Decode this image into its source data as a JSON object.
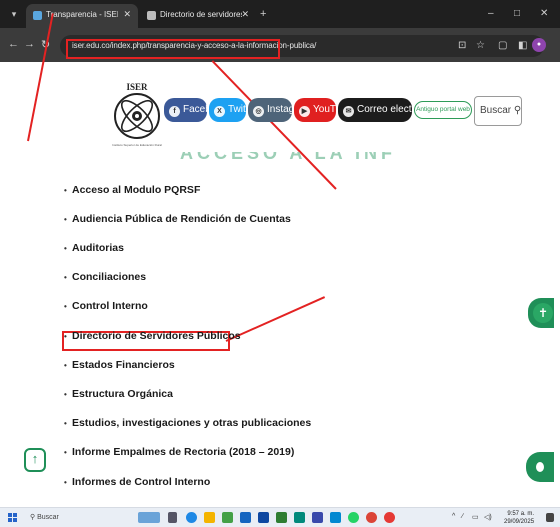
{
  "browser": {
    "tabs": [
      {
        "title": "Transparencia - ISER",
        "active": true
      },
      {
        "title": "Directorio de servidores públic",
        "active": false
      }
    ],
    "new_tab": "+",
    "minimize": "–",
    "maximize": "□",
    "close": "✕",
    "tab_close": "✕",
    "url": "iser.edu.co/index.php/transparencia-y-acceso-a-la-informacion-publica/"
  },
  "header": {
    "logo_text": "ISER",
    "logo_sub": "Instituto Superior de Educación Rural",
    "social": [
      {
        "label": "Facebook",
        "icon": "f",
        "color": "#3b5998"
      },
      {
        "label": "Twitter",
        "icon": "X",
        "color": "#1da1f2"
      },
      {
        "label": "Instagram",
        "icon": "◎",
        "color": "#4e6479"
      },
      {
        "label": "YouTube",
        "icon": "▶",
        "color": "#e02020"
      },
      {
        "label": "Correo electrónico",
        "icon": "✉",
        "color": "#1c1c1c"
      }
    ],
    "portal_label": "Antiguo portal web",
    "search_label": "Buscar",
    "heading": "ACCESO A LA INFORMACIÓN PÚBLICA"
  },
  "menu": [
    "Acceso al Modulo PQRSF",
    "Audiencia Pública de Rendición de Cuentas",
    "Auditorias",
    "Conciliaciones",
    "Control Interno",
    "Directorio de Servidores Públicos",
    "Estados Financieros",
    "Estructura Orgánica",
    "Estudios, investigaciones y otras publicaciones",
    "Informe Empalmes de Rectoria (2018 – 2019)",
    "Informes de Control Interno"
  ],
  "taskbar": {
    "search_placeholder": "Buscar",
    "time": "9:57 a. m.",
    "date": "29/09/2025"
  },
  "colors": {
    "annotation": "#e32222",
    "brand_green": "#1f8f58"
  }
}
